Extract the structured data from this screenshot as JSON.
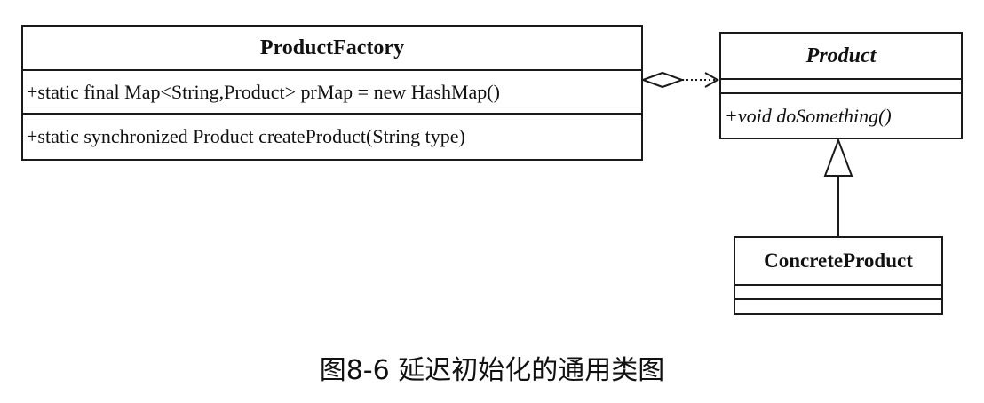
{
  "classes": {
    "product_factory": {
      "name": "ProductFactory",
      "attribute": "+static final Map<String,Product> prMap = new HashMap()",
      "operation": "+static synchronized  Product createProduct(String type)"
    },
    "product": {
      "name": "Product",
      "attribute": "",
      "operation": "+void doSomething()"
    },
    "concrete_product": {
      "name": "ConcreteProduct",
      "attribute": "",
      "operation": ""
    }
  },
  "relations": [
    {
      "type": "aggregation",
      "from": "ProductFactory",
      "to": "Product",
      "line": "dotted",
      "arrow": "open"
    },
    {
      "type": "generalization",
      "from": "ConcreteProduct",
      "to": "Product",
      "line": "solid",
      "arrow": "hollow-triangle"
    }
  ],
  "caption": "图8-6 延迟初始化的通用类图"
}
